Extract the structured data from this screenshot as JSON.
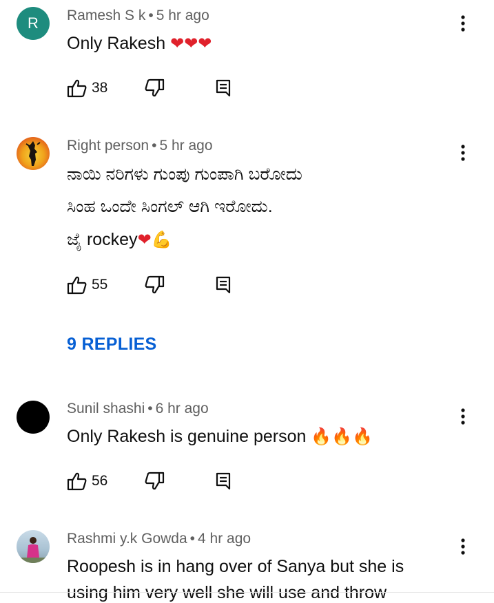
{
  "colors": {
    "accent": "#065fd4",
    "meta": "#606060",
    "text": "#0f0f0f"
  },
  "comments": [
    {
      "avatar_letter": "R",
      "avatar_color": "#1e8c7e",
      "author": "Ramesh S k",
      "time": "5 hr ago",
      "lines": [
        "Only Rakesh"
      ],
      "emoji": "❤❤❤",
      "likes": "38"
    },
    {
      "avatar_icon": "silhouette-avatar",
      "author": "Right person",
      "time": "5 hr ago",
      "lines": [
        "ನಾಯಿ ನರಿಗಳು ಗುಂಪು ಗುಂಪಾಗಿ ಬರೋದು",
        "ಸಿಂಹ ಒಂದೇ ಸಿಂಗಲ್ ಆಗಿ ಇರೋದು.",
        "ಜೈ rockey"
      ],
      "emoji": "❤💪",
      "likes": "55",
      "replies_label": "9 REPLIES"
    },
    {
      "avatar_color": "#000000",
      "author": "Sunil shashi",
      "time": "6 hr ago",
      "lines": [
        "Only Rakesh is genuine person"
      ],
      "emoji": "🔥🔥🔥",
      "likes": "56"
    },
    {
      "avatar_icon": "photo-avatar",
      "author": "Rashmi y.k Gowda",
      "time": "4 hr ago",
      "lines": [
        "Roopesh is in hang over of Sanya but she is",
        "using him very well she will use and throw"
      ]
    }
  ]
}
